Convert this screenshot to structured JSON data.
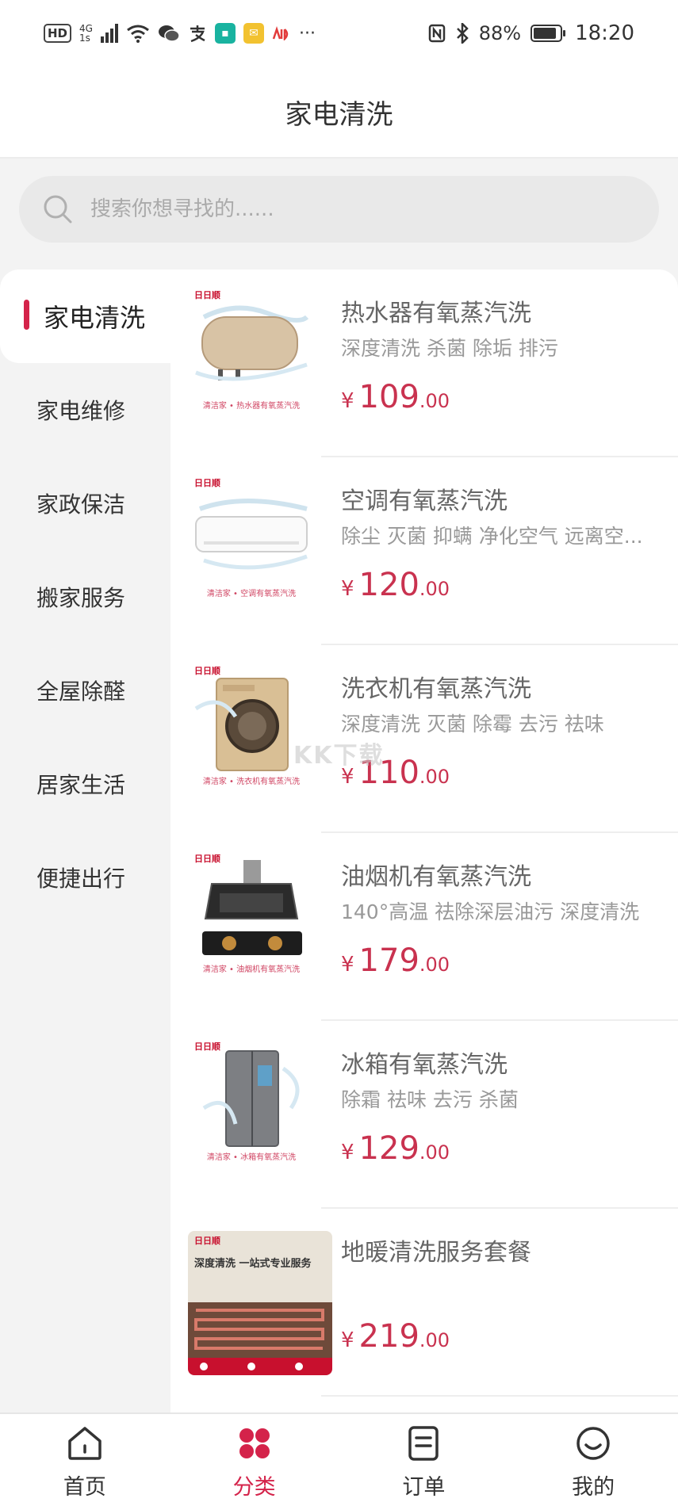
{
  "status_bar": {
    "hd": "HD",
    "network": "4G",
    "network_sub": "1s",
    "battery_percent": "88%",
    "battery_level": 0.88,
    "time": "18:20"
  },
  "header": {
    "title": "家电清洗"
  },
  "search": {
    "placeholder": "搜索你想寻找的......"
  },
  "sidebar": {
    "items": [
      {
        "label": "家电清洗",
        "active": true
      },
      {
        "label": "家电维修"
      },
      {
        "label": "家政保洁"
      },
      {
        "label": "搬家服务"
      },
      {
        "label": "全屋除醛"
      },
      {
        "label": "居家生活"
      },
      {
        "label": "便捷出行"
      }
    ]
  },
  "products": [
    {
      "title": "热水器有氧蒸汽洗",
      "desc": "深度清洗 杀菌 除垢 排污",
      "currency": "¥",
      "price_int": "109",
      "price_dec": ".00",
      "brand": "日日顺",
      "caption": "清洁家 • 热水器有氧蒸汽洗",
      "image": "water-heater-icon"
    },
    {
      "title": "空调有氧蒸汽洗",
      "desc": "除尘 灭菌 抑螨 净化空气 远离空...",
      "currency": "¥",
      "price_int": "120",
      "price_dec": ".00",
      "brand": "日日顺",
      "caption": "清洁家 • 空调有氧蒸汽洗",
      "image": "air-conditioner-icon"
    },
    {
      "title": "洗衣机有氧蒸汽洗",
      "desc": "深度清洗 灭菌 除霉 去污 祛味",
      "currency": "¥",
      "price_int": "110",
      "price_dec": ".00",
      "brand": "日日顺",
      "caption": "清洁家 • 洗衣机有氧蒸汽洗",
      "image": "washing-machine-icon"
    },
    {
      "title": "油烟机有氧蒸汽洗",
      "desc": "140°高温 祛除深层油污 深度清洗",
      "currency": "¥",
      "price_int": "179",
      "price_dec": ".00",
      "brand": "日日顺",
      "caption": "清洁家 • 油烟机有氧蒸汽洗",
      "image": "range-hood-icon"
    },
    {
      "title": "冰箱有氧蒸汽洗",
      "desc": "除霜 祛味 去污 杀菌",
      "currency": "¥",
      "price_int": "129",
      "price_dec": ".00",
      "brand": "日日顺",
      "caption": "清洁家 • 冰箱有氧蒸汽洗",
      "image": "refrigerator-icon"
    },
    {
      "title": "地暖清洗服务套餐",
      "desc": "",
      "currency": "¥",
      "price_int": "219",
      "price_dec": ".00",
      "brand": "日日顺",
      "caption": "深度清洗 一站式专业服务",
      "image": "floor-heating-icon"
    }
  ],
  "tabbar": {
    "items": [
      {
        "label": "首页",
        "icon": "home-icon"
      },
      {
        "label": "分类",
        "icon": "category-icon",
        "active": true
      },
      {
        "label": "订单",
        "icon": "order-icon"
      },
      {
        "label": "我的",
        "icon": "profile-icon"
      }
    ]
  },
  "watermark": "KK下载",
  "colors": {
    "accent": "#d4234a",
    "price": "#c9324f",
    "background": "#f3f3f3"
  }
}
